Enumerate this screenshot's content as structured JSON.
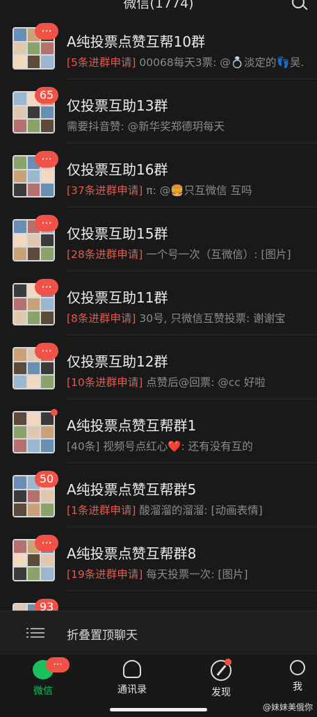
{
  "header": {
    "title": "微信(1774)"
  },
  "chats": [
    {
      "name": "A纯投票点赞互帮10群",
      "badge": "···",
      "request": "[5条进群申请]",
      "message": " 00068每天3票: @💍淡定的👣吴."
    },
    {
      "name": "仅投票互助13群",
      "badge": "65",
      "request": "",
      "message": "需要抖音赞: @新华奖郑德玥每天"
    },
    {
      "name": "仅投票互助16群",
      "badge": "···",
      "request": "[37条进群申请]",
      "message": " π: @🍔只互微信 互吗"
    },
    {
      "name": "仅投票互助15群",
      "badge": "···",
      "request": "[28条进群申请]",
      "message": " 一个号一次（互微信）: [图片]"
    },
    {
      "name": "仅投票互助11群",
      "badge": "···",
      "request": "[8条进群申请]",
      "message": " 30号, 只微信互赞投票: 谢谢宝"
    },
    {
      "name": "仅投票互助12群",
      "badge": "···",
      "request": "[10条进群申请]",
      "message": " 点赞后@回票: @cc 好啦"
    },
    {
      "name": "A纯投票点赞互帮群1",
      "badge": "",
      "request": "",
      "message": "[40条] 视频号点红心❤️: 还有没有互的"
    },
    {
      "name": "A纯投票点赞互帮群5",
      "badge": "50",
      "request": "[1条进群申请]",
      "message": " 酸溜溜的溜溜: [动画表情]"
    },
    {
      "name": "A纯投票点赞互帮群8",
      "badge": "···",
      "request": "[19条进群申请]",
      "message": " 每天投票一次: [图片]"
    },
    {
      "name": "",
      "badge": "93",
      "request": "",
      "message": ""
    }
  ],
  "fold": {
    "label": "折叠置顶聊天"
  },
  "tabs": [
    {
      "label": "微信",
      "badge": "···"
    },
    {
      "label": "通讯录",
      "badge": ""
    },
    {
      "label": "发现",
      "badge": ""
    },
    {
      "label": "我",
      "badge": ""
    }
  ],
  "watermark": "@妹妹美俄你",
  "colors": {
    "accent": "#19c05f",
    "badge": "#f05247",
    "request": "#e8574b"
  },
  "icons": [
    "search-icon",
    "fold-list-icon",
    "chat-icon",
    "contacts-icon",
    "compass-icon",
    "profile-icon"
  ]
}
